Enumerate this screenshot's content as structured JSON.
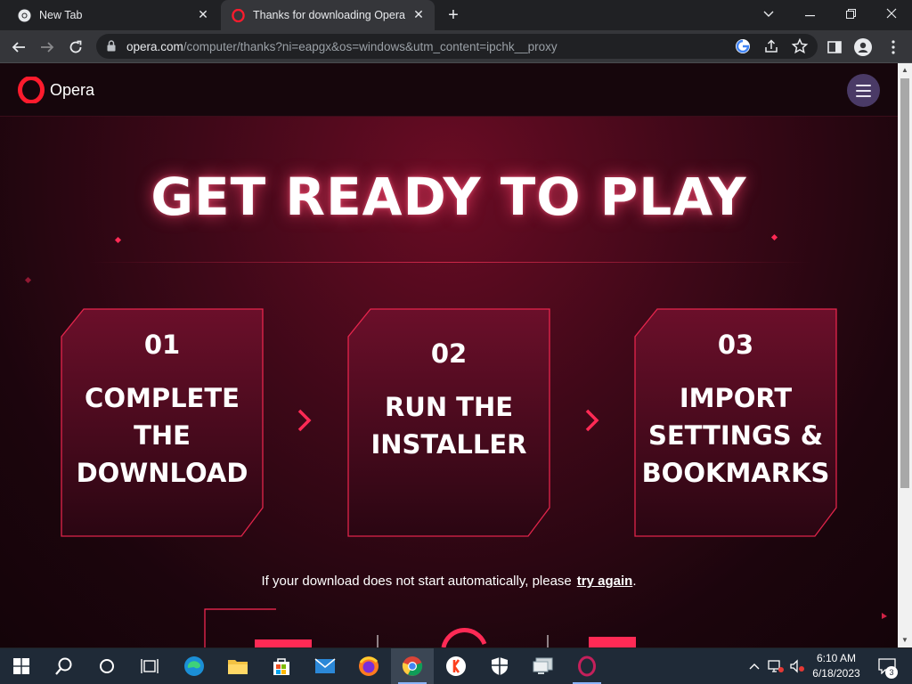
{
  "browser": {
    "tabs": [
      {
        "title": "New Tab",
        "active": false
      },
      {
        "title": "Thanks for downloading Opera",
        "active": true
      }
    ],
    "url_host": "opera.com",
    "url_path": "/computer/thanks?ni=eapgx&os=windows&utm_content=ipchk__proxy"
  },
  "site": {
    "logo_text": "Opera",
    "hero_title": "GET READY TO PLAY",
    "steps": [
      {
        "number": "01",
        "lines": [
          "COMPLETE",
          "THE",
          "DOWNLOAD"
        ]
      },
      {
        "number": "02",
        "lines": [
          "RUN THE",
          "INSTALLER"
        ]
      },
      {
        "number": "03",
        "lines": [
          "IMPORT",
          "SETTINGS &",
          "BOOKMARKS"
        ]
      }
    ],
    "retry_text": "If your download does not start automatically, please",
    "retry_link": "try again",
    "retry_suffix": "."
  },
  "taskbar": {
    "time": "6:10 AM",
    "date": "6/18/2023",
    "notification_count": "3"
  },
  "colors": {
    "accent": "#ff1f4f",
    "card_fill_top": "#6b0f2a",
    "card_fill_bottom": "#2a0612",
    "menu_button": "#4a3a66"
  }
}
